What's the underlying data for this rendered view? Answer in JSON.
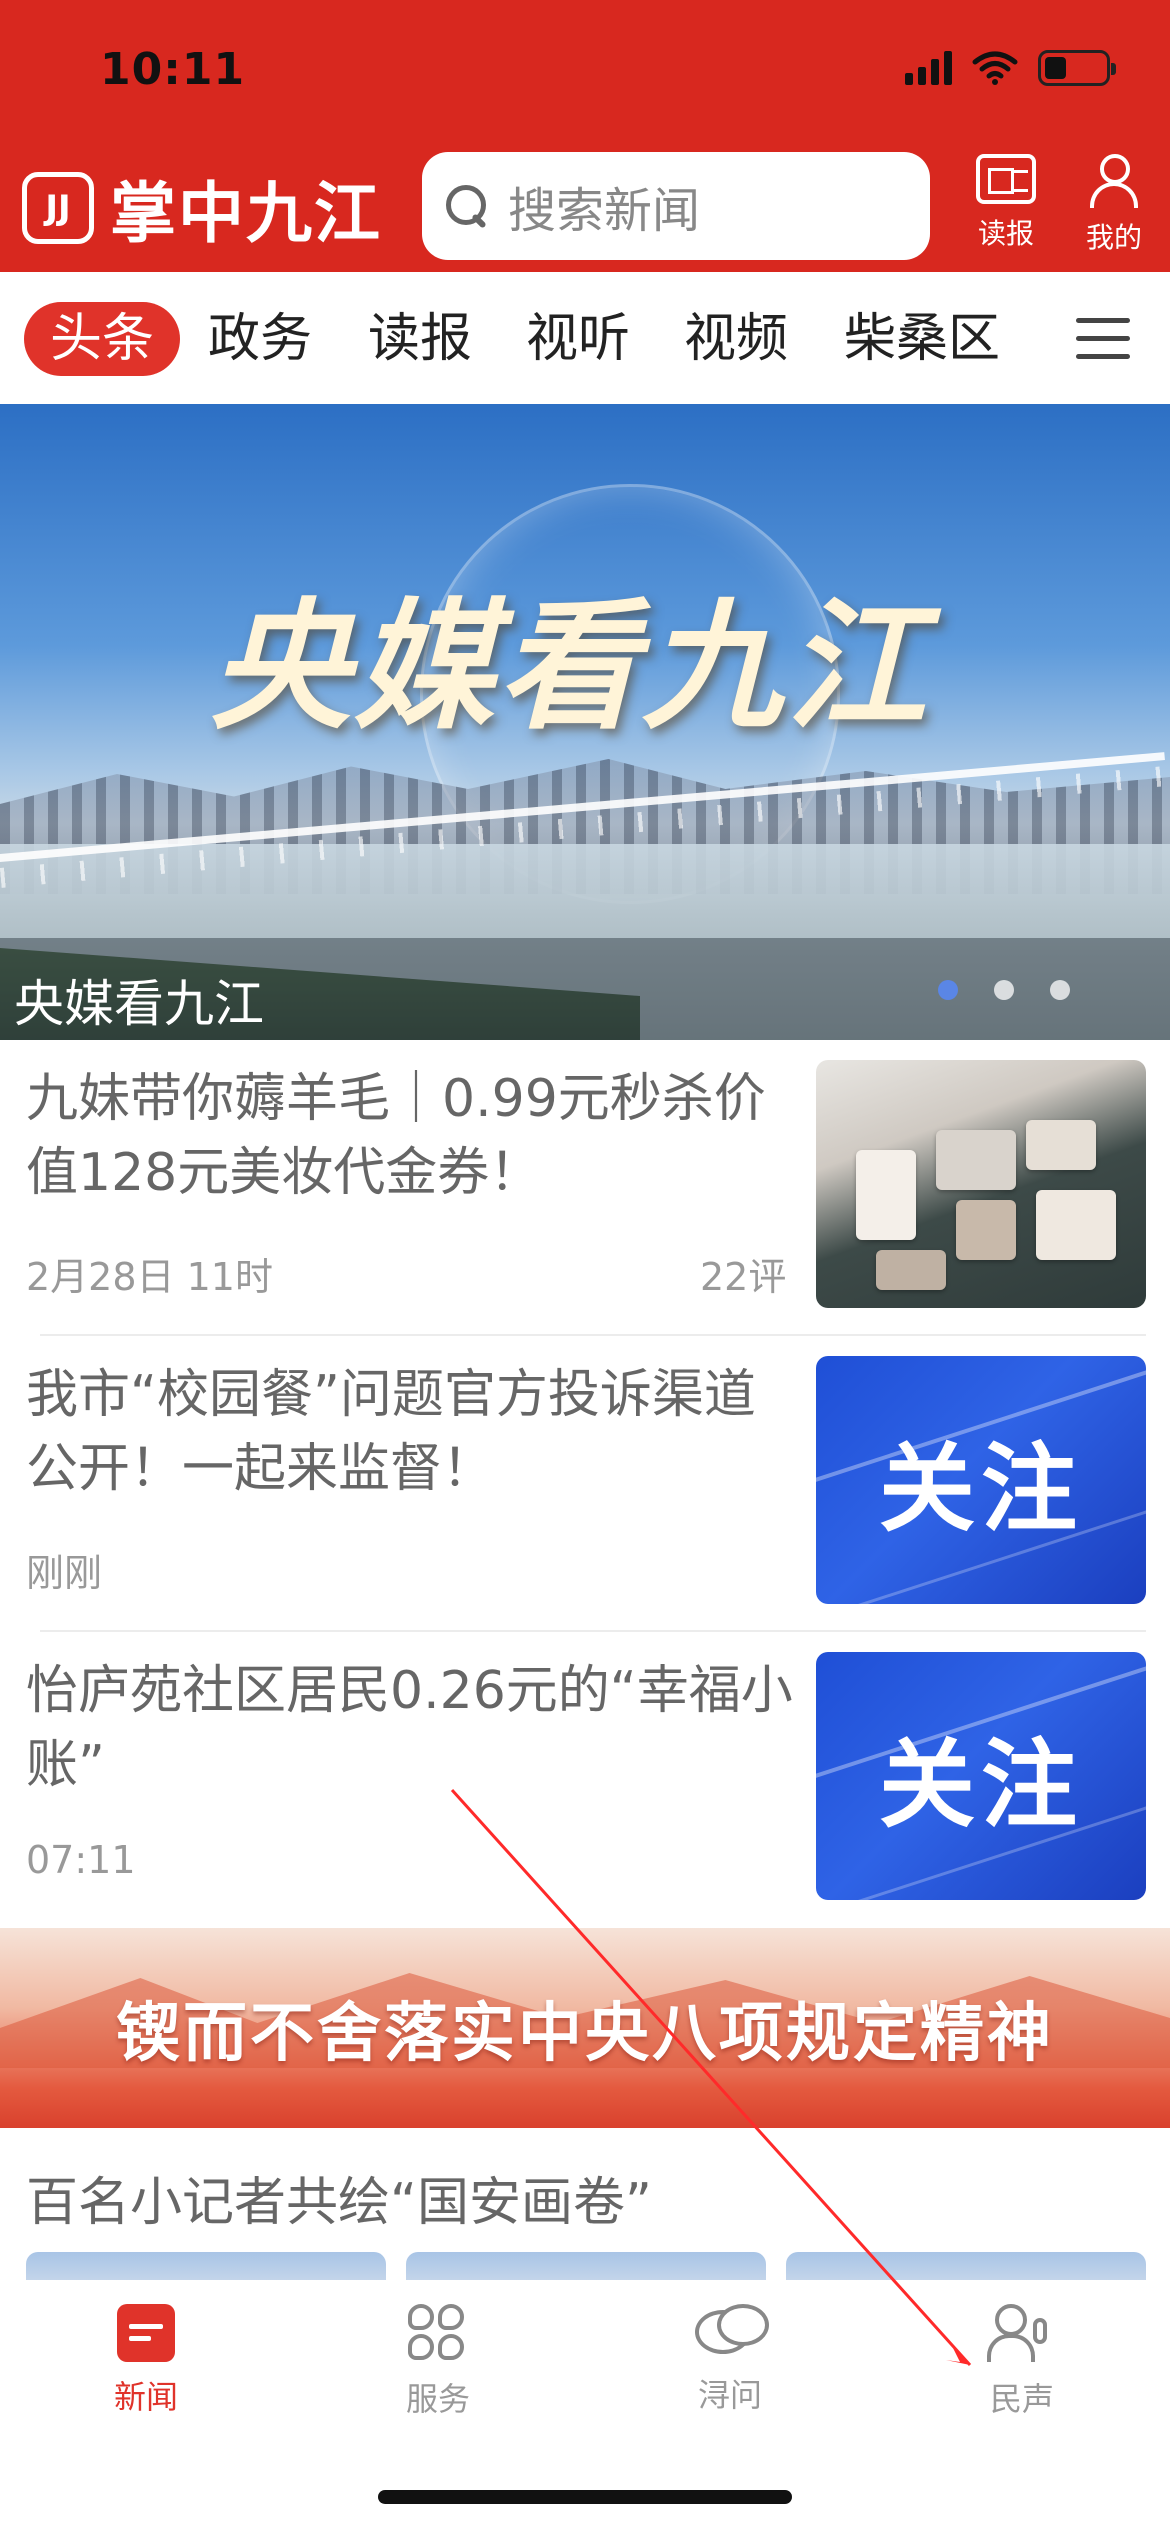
{
  "status_bar": {
    "time": "10:11"
  },
  "header": {
    "brand_name": "掌中九江",
    "search_placeholder": "搜索新闻",
    "btn_newspaper": "读报",
    "btn_profile": "我的"
  },
  "tabs": [
    "头条",
    "政务",
    "读报",
    "视听",
    "视频",
    "柴桑区"
  ],
  "banner": {
    "title": "央媒看九江",
    "caption": "央媒看九江",
    "slide_count": 3,
    "active_slide": 1
  },
  "news": [
    {
      "title": "九妹带你薅羊毛｜0.99元秒杀价值128元美妆代金券！",
      "time": "2月28日 11时",
      "comments": "22评"
    },
    {
      "title": "我市“校园餐”问题官方投诉渠道公开！一起来监督！",
      "time": "刚刚",
      "thumb_text": "关注"
    },
    {
      "title": "怡庐苑社区居民0.26元的“幸福小账”",
      "time": "07:11",
      "thumb_text": "关注"
    }
  ],
  "promo": {
    "text": "锲而不舍落实中央八项规定精神"
  },
  "section": {
    "title": "百名小记者共绘“国安画卷”"
  },
  "bottom_nav": [
    {
      "label": "新闻",
      "icon": "news-icon",
      "active": true
    },
    {
      "label": "服务",
      "icon": "service-icon"
    },
    {
      "label": "浔问",
      "icon": "chat-icon"
    },
    {
      "label": "民声",
      "icon": "voice-icon"
    }
  ],
  "colors": {
    "brand_red": "#d8281f",
    "active_tab": "#e0332a"
  }
}
